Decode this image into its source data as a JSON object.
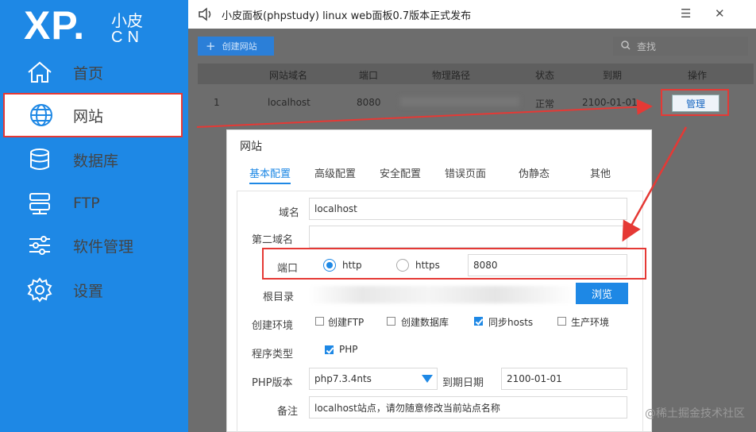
{
  "logo": {
    "xp": "XP.",
    "cn_top": "小皮",
    "cn_bottom": "CN"
  },
  "sidebar": {
    "items": [
      {
        "label": "首页",
        "icon": "home-icon",
        "active": false
      },
      {
        "label": "网站",
        "icon": "globe-icon",
        "active": true
      },
      {
        "label": "数据库",
        "icon": "database-icon",
        "active": false
      },
      {
        "label": "FTP",
        "icon": "server-icon",
        "active": false
      },
      {
        "label": "软件管理",
        "icon": "sliders-icon",
        "active": false
      },
      {
        "label": "设置",
        "icon": "gear-icon",
        "active": false
      }
    ]
  },
  "titlebar": {
    "title": "小皮面板(phpstudy) linux web面板0.7版本正式发布",
    "menu": "☰",
    "close": "✕"
  },
  "toolbar": {
    "create_label": "创建网站",
    "search_placeholder": "查找"
  },
  "table": {
    "headers": [
      "网站域名",
      "端口",
      "物理路径",
      "状态",
      "到期",
      "操作"
    ],
    "rows": [
      {
        "index": "1",
        "domain": "localhost",
        "port": "8080",
        "status": "正常",
        "expire": "2100-01-01",
        "action": "管理"
      }
    ]
  },
  "dialog": {
    "title": "网站",
    "tabs": [
      "基本配置",
      "高级配置",
      "安全配置",
      "错误页面",
      "伪静态",
      "其他"
    ],
    "fields": {
      "domain_label": "域名",
      "domain_value": "localhost",
      "second_domain_label": "第二域名",
      "second_domain_value": "",
      "port_label": "端口",
      "http_label": "http",
      "https_label": "https",
      "port_value": "8080",
      "root_label": "根目录",
      "browse_label": "浏览",
      "env_label": "创建环境",
      "env_options": [
        {
          "label": "创建FTP",
          "checked": false
        },
        {
          "label": "创建数据库",
          "checked": false
        },
        {
          "label": "同步hosts",
          "checked": true
        },
        {
          "label": "生产环境",
          "checked": false
        }
      ],
      "program_label": "程序类型",
      "program_option": "PHP",
      "php_label": "PHP版本",
      "php_value": "php7.3.4nts",
      "expire_label": "到期日期",
      "expire_value": "2100-01-01",
      "note_label": "备注",
      "note_value": "localhost站点，请勿随意修改当前站点名称"
    }
  },
  "watermark": "@稀土掘金技术社区",
  "colors": {
    "accent": "#1e88e5",
    "highlight": "#e53935"
  }
}
